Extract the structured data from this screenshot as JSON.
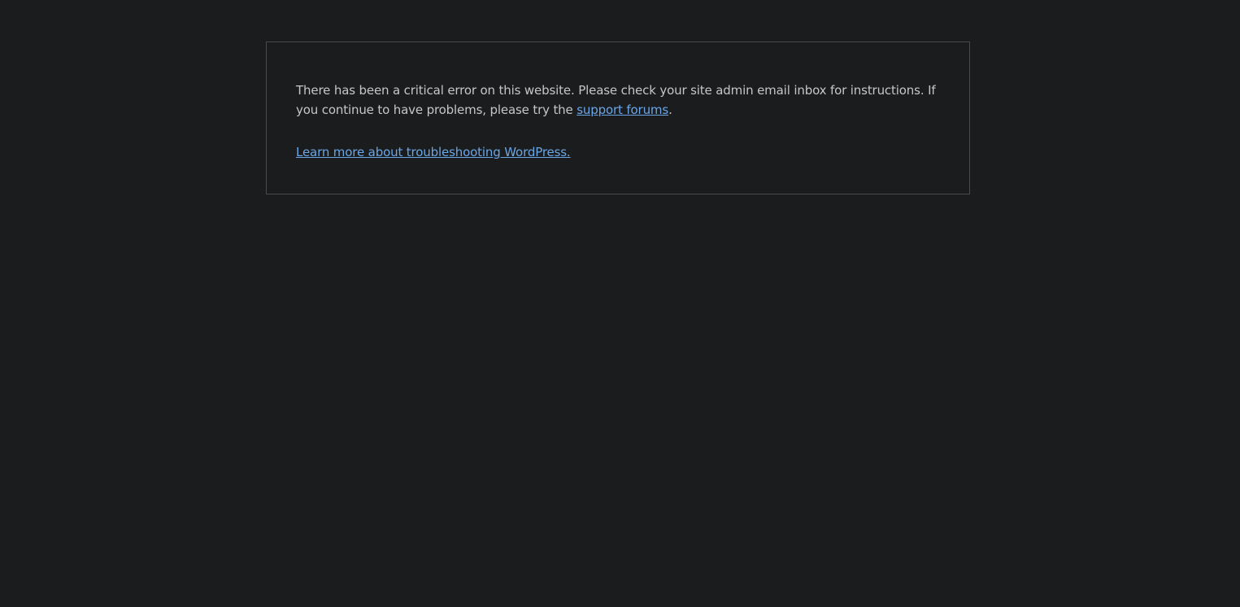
{
  "error": {
    "message_part1": "There has been a critical error on this website. Please check your site admin email inbox for instructions. If you continue to have problems, please try the ",
    "support_link_label": "support forums",
    "message_part2": ".",
    "learn_more_label": "Learn more about troubleshooting WordPress."
  },
  "colors": {
    "background": "#1b1c1e",
    "text": "#c5c6c8",
    "link": "#6aa6e6",
    "border": "#4a4b4e"
  }
}
